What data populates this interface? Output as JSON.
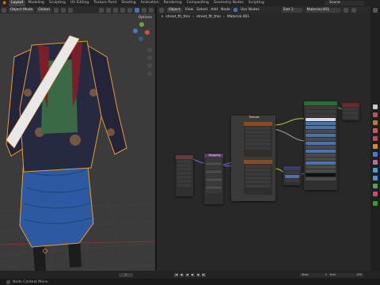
{
  "topbar": {
    "workspaces": [
      "Layout",
      "Modeling",
      "Sculpting",
      "UV Editing",
      "Texture Paint",
      "Shading",
      "Animation",
      "Rendering",
      "Compositing",
      "Geometry Nodes",
      "Scripting"
    ],
    "active_workspace": "Layout",
    "scene_label": "Scene"
  },
  "viewport": {
    "mode_label": "Object Mode",
    "transform_label": "Global",
    "options_label": "Options"
  },
  "node_editor": {
    "header_items": [
      "Object",
      "View",
      "Select",
      "Add",
      "Node"
    ],
    "use_nodes_label": "Use Nodes",
    "slot_label": "Slot 1",
    "material_field": "Material.001",
    "breadcrumb": [
      "street_fit_thin",
      "street_fit_thin",
      "Material.001"
    ],
    "nodes": {
      "texture_title": "Texture",
      "mapping_title": "Mapping"
    }
  },
  "timeline": {
    "start_label": "Start",
    "start_value": "1",
    "end_label": "End",
    "end_value": "250",
    "current_frame": "1"
  },
  "statusbar": {
    "text": "Node Context Menu"
  },
  "colors": {
    "accent": "#e87d0d",
    "selection": "#4772b3",
    "texture_node_header": "#8a4c1e",
    "bsdf_node_header": "#2a6b3a",
    "mapping_node_header": "#6a3a3a"
  }
}
